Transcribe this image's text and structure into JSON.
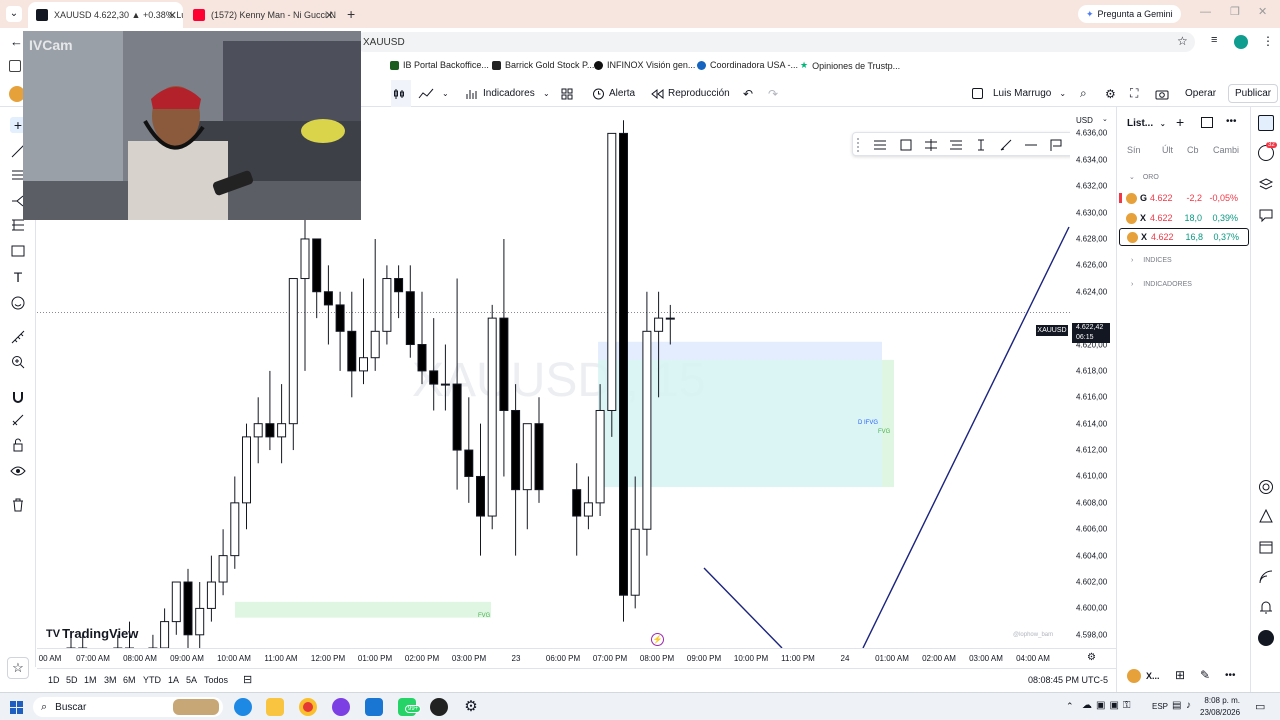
{
  "browser": {
    "tabs": [
      {
        "label": "XAUUSD 4.622,30 ▲ +0.38% Lu",
        "active": true
      },
      {
        "label": "(1572) Kenny Man - Ni Gucci N",
        "active": false
      }
    ],
    "gemini_label": "Pregunta a Gemini",
    "address": "XAUUSD",
    "bookmarks": [
      "IB Portal Backoffice...",
      "Barrick Gold Stock P...",
      "INFINOX Visión gen...",
      "Coordinadora USA -...",
      "Opiniones de Trustp..."
    ]
  },
  "toolbar": {
    "indicators": "Indicadores",
    "alert": "Alerta",
    "replay": "Reproducción",
    "layout_name": "Luis Marrugo",
    "trade": "Operar",
    "publish": "Publicar"
  },
  "chart": {
    "watermark": "XAUUSD , 15",
    "logo": "TradingView",
    "fvg_label_top": "D IFVG",
    "fvg_label_small": "FVG",
    "fvg_label_bottom": "FVG",
    "credit": "@lophow_bam",
    "currency": "USD",
    "symbol_tag": "XAUUSD",
    "last_price": "4.622,42",
    "countdown": "06:15",
    "price_ticks": [
      "4.636,00",
      "4.634,00",
      "4.632,00",
      "4.630,00",
      "4.628,00",
      "4.626,00",
      "4.624,00",
      "4.620,00",
      "4.618,00",
      "4.616,00",
      "4.614,00",
      "4.612,00",
      "4.610,00",
      "4.608,00",
      "4.606,00",
      "4.604,00",
      "4.602,00",
      "4.600,00",
      "4.598,00"
    ],
    "time_ticks": [
      "00 AM",
      "07:00 AM",
      "08:00 AM",
      "09:00 AM",
      "10:00 AM",
      "11:00 AM",
      "12:00 PM",
      "01:00 PM",
      "02:00 PM",
      "03:00 PM",
      "23",
      "06:00 PM",
      "07:00 PM",
      "08:00 PM",
      "09:00 PM",
      "10:00 PM",
      "11:00 PM",
      "24",
      "01:00 AM",
      "02:00 AM",
      "03:00 AM",
      "04:00 AM"
    ]
  },
  "chart_data": {
    "type": "candlestick",
    "symbol": "XAUUSD",
    "timeframe": "15",
    "ylim": [
      4597,
      4638
    ],
    "x": [
      "07:00 AM",
      "07:15 AM",
      "07:30 AM",
      "07:45 AM",
      "08:00 AM",
      "08:15 AM",
      "08:30 AM",
      "08:45 AM",
      "09:00 AM",
      "09:15 AM",
      "09:30 AM",
      "09:45 AM",
      "10:00 AM",
      "10:15 AM",
      "10:30 AM",
      "10:45 AM",
      "11:00 AM",
      "11:15 AM",
      "11:30 AM",
      "11:45 AM",
      "12:00 PM",
      "12:15 PM",
      "12:30 PM",
      "12:45 PM",
      "01:00 PM",
      "01:15 PM",
      "01:30 PM",
      "01:45 PM",
      "02:00 PM",
      "02:15 PM",
      "02:30 PM",
      "02:45 PM",
      "03:00 PM",
      "03:15 PM",
      "03:30 PM",
      "03:45 PM",
      "04:00 PM",
      "04:15 PM",
      "04:30 PM",
      "04:45 PM",
      "05:00 PM",
      "06:00 PM",
      "06:15 PM",
      "06:30 PM",
      "06:45 PM",
      "07:00 PM",
      "07:15 PM",
      "07:30 PM",
      "07:45 PM",
      "08:00 PM"
    ],
    "open": [
      4596,
      4597,
      4596,
      4595,
      4596,
      4597,
      4596,
      4596,
      4597,
      4599,
      4602,
      4598,
      4600,
      4602,
      4604,
      4608,
      4613,
      4614,
      4613,
      4614,
      4625,
      4628,
      4624,
      4623,
      4621,
      4618,
      4619,
      4621,
      4625,
      4624,
      4620,
      4618,
      4617,
      4617,
      4612,
      4610,
      4607,
      4622,
      4615,
      4609,
      4614,
      4609,
      4607,
      4608,
      4615,
      4636,
      4601,
      4606,
      4621,
      4622
    ],
    "high": [
      4598,
      4598,
      4597,
      4597,
      4598,
      4599,
      4597,
      4598,
      4600,
      4602,
      4603,
      4602,
      4604,
      4606,
      4610,
      4614,
      4616,
      4618,
      4617,
      4618,
      4630,
      4628,
      4626,
      4624,
      4624,
      4625,
      4628,
      4626,
      4626,
      4626,
      4624,
      4622,
      4620,
      4625,
      4616,
      4614,
      4623,
      4628,
      4617,
      4614,
      4616,
      4611,
      4610,
      4617,
      4625,
      4637,
      4610,
      4624,
      4624,
      4623
    ],
    "low": [
      4595,
      4596,
      4595,
      4594,
      4595,
      4596,
      4595,
      4595,
      4596,
      4598,
      4596,
      4596,
      4599,
      4601,
      4603,
      4606,
      4611,
      4612,
      4611,
      4612,
      4618,
      4622,
      4620,
      4618,
      4616,
      4617,
      4618,
      4620,
      4622,
      4619,
      4617,
      4615,
      4615,
      4609,
      4608,
      4604,
      4606,
      4610,
      4604,
      4606,
      4608,
      4604,
      4606,
      4607,
      4613,
      4599,
      4600,
      4604,
      4616,
      4620
    ],
    "close": [
      4597,
      4596,
      4595,
      4596,
      4597,
      4596,
      4596,
      4597,
      4599,
      4602,
      4598,
      4600,
      4602,
      4604,
      4608,
      4613,
      4614,
      4613,
      4614,
      4625,
      4628,
      4624,
      4623,
      4621,
      4618,
      4619,
      4621,
      4625,
      4624,
      4620,
      4618,
      4617,
      4617,
      4612,
      4610,
      4607,
      4622,
      4615,
      4609,
      4614,
      4609,
      4607,
      4608,
      4615,
      4636,
      4601,
      4606,
      4621,
      4622,
      4622
    ],
    "zones": [
      {
        "label": "D IFVG",
        "from": "06:30 PM",
        "price_top": 4620.2,
        "price_bottom": 4609.2
      },
      {
        "label": "FVG",
        "from": "10:00 AM",
        "price_top": 4600.5,
        "price_bottom": 4599.3
      }
    ],
    "last_price": 4622.42
  },
  "bottom": {
    "timeframes": [
      "1D",
      "5D",
      "1M",
      "3M",
      "6M",
      "YTD",
      "1A",
      "5A",
      "Todos"
    ],
    "clock": "08:08:45 PM UTC-5"
  },
  "watchlist": {
    "title": "List...",
    "cols": [
      "Sín",
      "Últ",
      "Cb",
      "Cambi"
    ],
    "section_gold": "ORO",
    "rows": [
      {
        "sym": "G",
        "last": "4.622",
        "chg": "-2,2",
        "pct": "-0,05%",
        "color": "#f23645"
      },
      {
        "sym": "X",
        "last": "4.622",
        "chg": "18,0",
        "pct": "0,39%",
        "color": "#089981"
      },
      {
        "sym": "X",
        "last": "4.622",
        "chg": "16,8",
        "pct": "0,37%",
        "color": "#089981"
      }
    ],
    "section_indices": "INDICES",
    "section_indicators": "INDICADORES",
    "badge": "32",
    "footer_sym": "X..."
  },
  "webcam": {
    "watermark": "IVCam"
  },
  "taskbar": {
    "search": "Buscar",
    "lang": "ESP",
    "time": "8:08 p. m.",
    "date": "23/08/2026",
    "badge": "99+"
  },
  "colors": {
    "up": "#ffffff",
    "down": "#000000",
    "fvg": "#d5f3f2",
    "fvg_green": "#dcf5e0",
    "trend": "#1a237e",
    "accent": "#2962ff"
  }
}
